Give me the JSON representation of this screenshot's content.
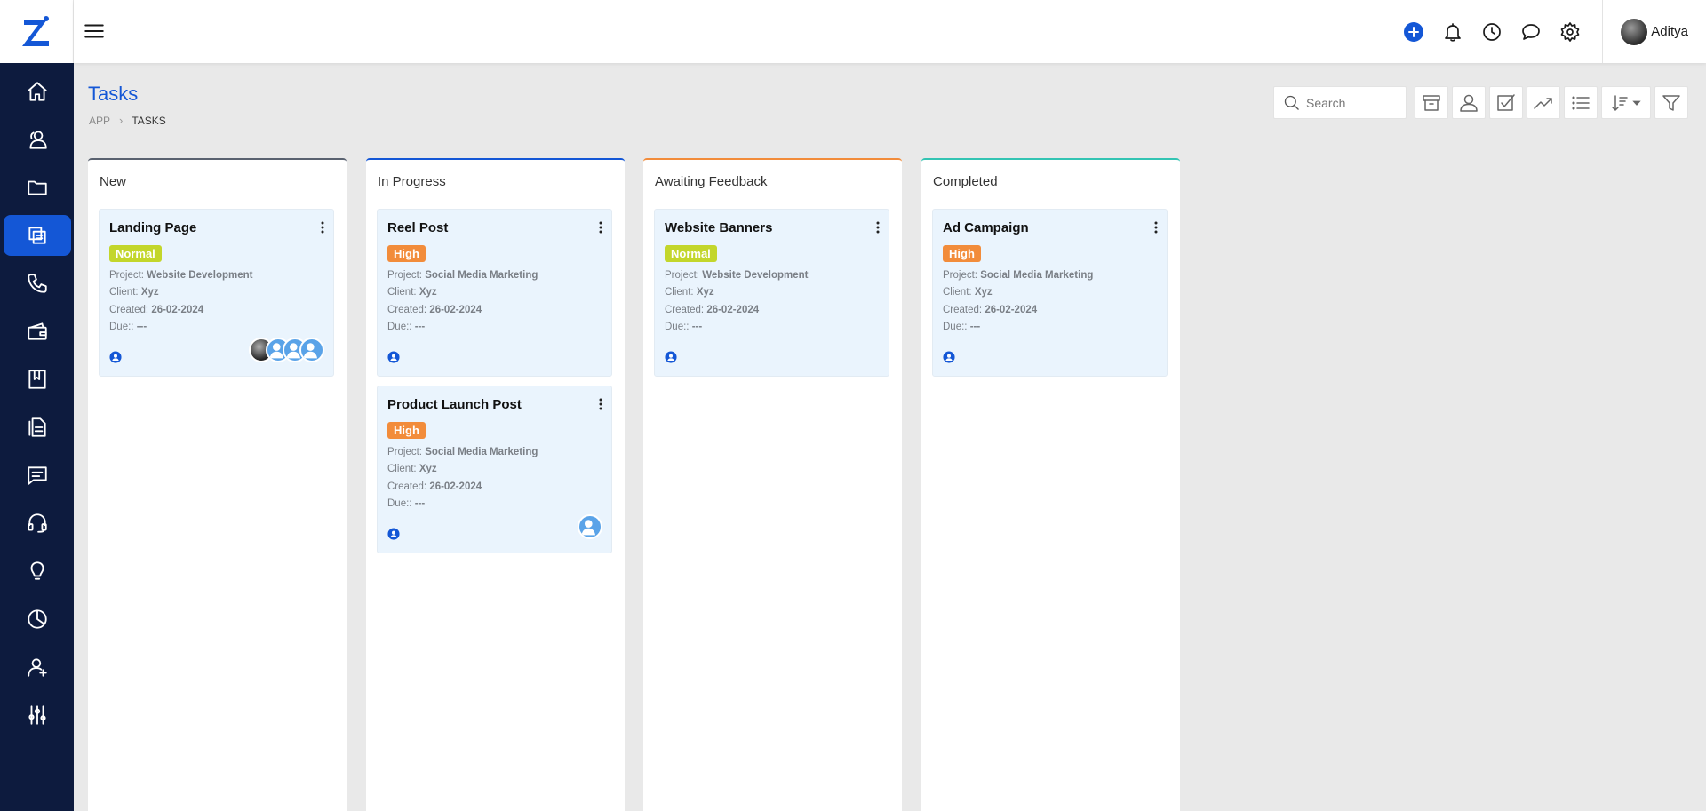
{
  "app": {
    "user_name": "Aditya",
    "accent": "#1457d6",
    "sidebar_bg": "#0d1b3e"
  },
  "sidebar": {
    "items": [
      {
        "name": "home-icon"
      },
      {
        "name": "contacts-icon"
      },
      {
        "name": "folder-icon"
      },
      {
        "name": "tasks-icon",
        "active": true
      },
      {
        "name": "phone-icon"
      },
      {
        "name": "wallet-icon"
      },
      {
        "name": "book-icon"
      },
      {
        "name": "documents-icon"
      },
      {
        "name": "messages-icon"
      },
      {
        "name": "support-headset-icon"
      },
      {
        "name": "lightbulb-icon"
      },
      {
        "name": "pie-chart-icon"
      },
      {
        "name": "add-user-icon"
      },
      {
        "name": "sliders-icon"
      }
    ]
  },
  "header": {
    "title": "Tasks",
    "breadcrumb": [
      "APP",
      "TASKS"
    ],
    "search_placeholder": "Search"
  },
  "board": {
    "columns": [
      {
        "title": "New",
        "color": "#5a6270",
        "cards": [
          {
            "title": "Landing Page",
            "priority": "Normal",
            "priority_color": "#c3d62b",
            "project_label": "Project:",
            "project": "Website Development",
            "client_label": "Client:",
            "client": "Xyz",
            "created_label": "Created:",
            "created": "26-02-2024",
            "due_label": "Due::",
            "due": "---"
          }
        ]
      },
      {
        "title": "In Progress",
        "color": "#1457d6",
        "cards": [
          {
            "title": "Reel Post",
            "priority": "High",
            "priority_color": "#f28c3b",
            "project_label": "Project:",
            "project": "Social Media Marketing",
            "client_label": "Client:",
            "client": "Xyz",
            "created_label": "Created:",
            "created": "26-02-2024",
            "due_label": "Due::",
            "due": "---"
          },
          {
            "title": "Product Launch Post",
            "priority": "High",
            "priority_color": "#f28c3b",
            "project_label": "Project:",
            "project": "Social Media Marketing",
            "client_label": "Client:",
            "client": "Xyz",
            "created_label": "Created:",
            "created": "26-02-2024",
            "due_label": "Due::",
            "due": "---"
          }
        ]
      },
      {
        "title": "Awaiting Feedback",
        "color": "#f28c3b",
        "cards": [
          {
            "title": "Website Banners",
            "priority": "Normal",
            "priority_color": "#c3d62b",
            "project_label": "Project:",
            "project": "Website Development",
            "client_label": "Client:",
            "client": "Xyz",
            "created_label": "Created:",
            "created": "26-02-2024",
            "due_label": "Due::",
            "due": "---"
          }
        ]
      },
      {
        "title": "Completed",
        "color": "#33c4b3",
        "cards": [
          {
            "title": "Ad Campaign",
            "priority": "High",
            "priority_color": "#f28c3b",
            "project_label": "Project:",
            "project": "Social Media Marketing",
            "client_label": "Client:",
            "client": "Xyz",
            "created_label": "Created:",
            "created": "26-02-2024",
            "due_label": "Due::",
            "due": "---"
          }
        ]
      }
    ]
  }
}
